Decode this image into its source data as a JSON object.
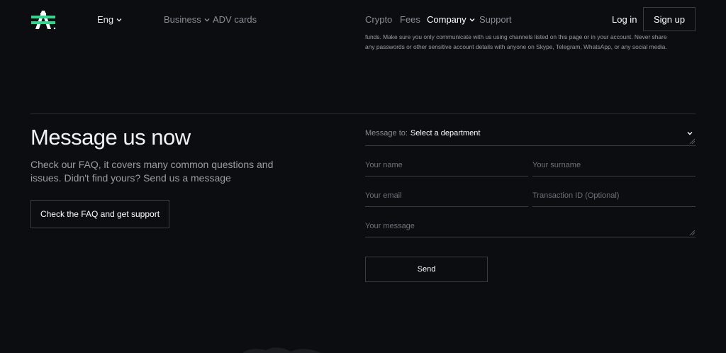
{
  "header": {
    "logo_icon": "advcash-logo-icon",
    "language": "Eng",
    "nav_left": [
      "Business",
      "ADV cards"
    ],
    "nav_right": [
      "Crypto",
      "Fees",
      "Company",
      "Support"
    ],
    "active_nav": "Company",
    "login_label": "Log in",
    "signup_label": "Sign up"
  },
  "warning": {
    "line1": "funds. Make sure you only communicate with us using channels listed on this page or in your account. Never share",
    "line2": "any passwords or other sensitive account details with anyone on Skype, Telegram, WhatsApp, or any social media."
  },
  "contact": {
    "title": "Message us now",
    "subtitle": "Check our FAQ, it covers many common questions and issues. Didn't find yours? Send us a message",
    "faq_button": "Check the FAQ and get support"
  },
  "form": {
    "department_label": "Message to:",
    "department_value": "Select a department",
    "name_placeholder": "Your name",
    "surname_placeholder": "Your surname",
    "email_placeholder": "Your email",
    "transaction_placeholder": "Transaction ID (Optional)",
    "message_placeholder": "Your message",
    "send_label": "Send"
  },
  "colors": {
    "background": "#0c0d11",
    "logo_green": "#2bd88c",
    "text_muted": "#8b8e96"
  }
}
